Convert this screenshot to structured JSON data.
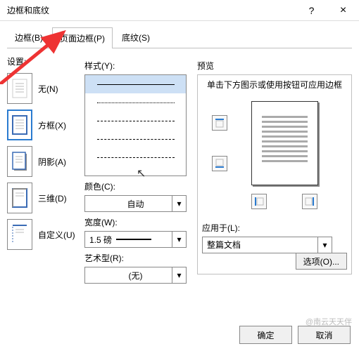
{
  "titlebar": {
    "title": "边框和底纹"
  },
  "tabs": {
    "border": "边框(B)",
    "page_border": "页面边框(P)",
    "shading": "底纹(S)"
  },
  "settings": {
    "label": "设置:",
    "none": "无(N)",
    "box": "方框(X)",
    "shadow": "阴影(A)",
    "threeD": "三维(D)",
    "custom": "自定义(U)"
  },
  "style": {
    "label": "样式(Y):",
    "color_label": "颜色(C):",
    "color_value": "自动",
    "width_label": "宽度(W):",
    "width_value": "1.5 磅",
    "art_label": "艺术型(R):",
    "art_value": "(无)"
  },
  "preview": {
    "label": "预览",
    "hint": "单击下方图示或使用按钮可应用边框",
    "apply_label": "应用于(L):",
    "apply_value": "整篇文档",
    "options": "选项(O)..."
  },
  "footer": {
    "ok": "确定",
    "cancel": "取消"
  },
  "watermark": "@南云天天伴"
}
